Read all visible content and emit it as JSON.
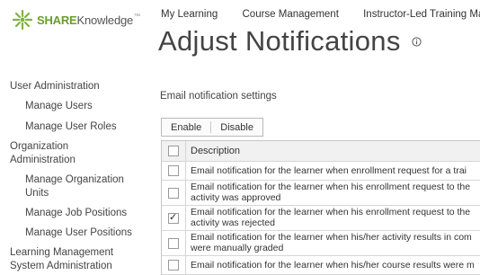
{
  "logo": {
    "share": "SHARE",
    "knowledge": "Knowledge",
    "tm": "™"
  },
  "topnav": [
    "My Learning",
    "Course Management",
    "Instructor-Led Training Mana"
  ],
  "page": {
    "title": "Adjust Notifications"
  },
  "sidebar": {
    "user_admin": "User Administration",
    "manage_users": "Manage Users",
    "manage_user_roles": "Manage User Roles",
    "org_admin": [
      "Organization",
      "Administration"
    ],
    "manage_org_units": [
      "Manage Organization",
      "Units"
    ],
    "manage_job_positions": "Manage Job Positions",
    "manage_user_positions": "Manage User Positions",
    "lms_admin": [
      "Learning Management",
      "System Administration"
    ]
  },
  "section_label": "Email notification settings",
  "toolbar": {
    "enable": "Enable",
    "disable": "Disable"
  },
  "table": {
    "header": "Description",
    "rows": [
      {
        "line1": "Email notification for the learner when enrollment request for a trai",
        "line2": "",
        "checked": false
      },
      {
        "line1": "Email notification for the learner when his enrollment request to the",
        "line2": "activity was approved",
        "checked": false
      },
      {
        "line1": "Email notification for the learner when his enrollment request to the",
        "line2": "activity was rejected",
        "checked": true
      },
      {
        "line1": "Email notification for the learner when his/her activity results in com",
        "line2": "were manually graded",
        "checked": false
      },
      {
        "line1": "Email notification for the learner when his/her course results were m",
        "line2": "",
        "checked": false
      }
    ]
  },
  "colors": {
    "brand_green": "#6a9e2b",
    "text": "#333333"
  }
}
